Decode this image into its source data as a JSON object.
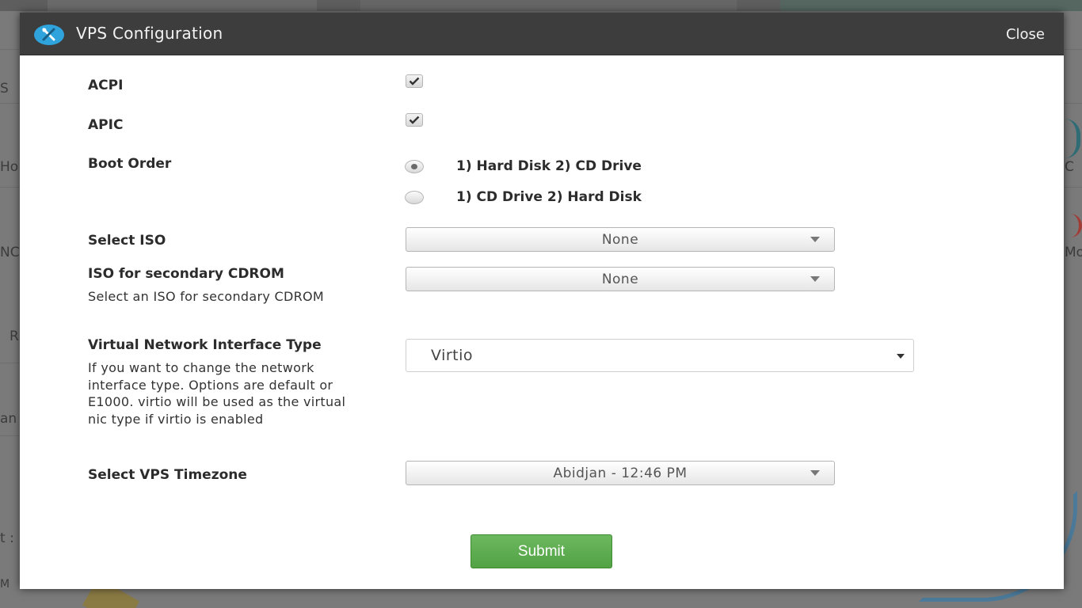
{
  "background": {
    "fragments": [
      "S",
      "Ho",
      "NC",
      "R",
      "an",
      "t :",
      "M",
      "Mo",
      "C"
    ]
  },
  "modal": {
    "title": "VPS Configuration",
    "close_label": "Close",
    "header_icon": "tools-icon",
    "fields": {
      "acpi": {
        "label": "ACPI",
        "checked": true
      },
      "apic": {
        "label": "APIC",
        "checked": true
      },
      "boot_order": {
        "label": "Boot Order",
        "options": [
          "1) Hard Disk 2) CD Drive",
          "1) CD Drive 2) Hard Disk"
        ],
        "selected": "1) Hard Disk 2) CD Drive"
      },
      "select_iso": {
        "label": "Select ISO",
        "value": "None"
      },
      "secondary_iso": {
        "label": "ISO for secondary CDROM",
        "help": "Select an ISO for secondary CDROM",
        "value": "None"
      },
      "nic_type": {
        "label": "Virtual Network Interface Type",
        "help": "If you want to change the network interface type. Options are default or E1000. virtio will be used as the virtual nic type if virtio is enabled",
        "value": "Virtio"
      },
      "timezone": {
        "label": "Select VPS Timezone",
        "value": "Abidjan - 12:46 PM"
      }
    },
    "submit_label": "Submit"
  },
  "colors": {
    "header_bg": "#3d3d3d",
    "submit_green": "#5cad4f",
    "icon_blue": "#2fa3dc"
  }
}
